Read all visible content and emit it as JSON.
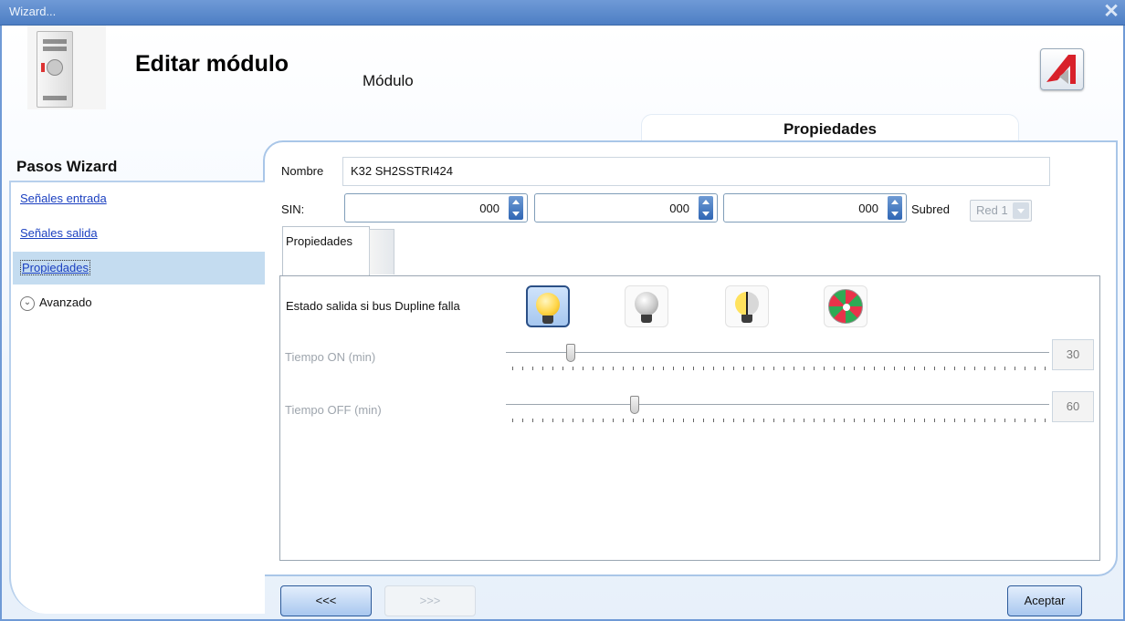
{
  "window": {
    "title": "Wizard..."
  },
  "header": {
    "title": "Editar módulo",
    "subtitle": "Módulo",
    "section_tab": "Propiedades"
  },
  "sidebar": {
    "title": "Pasos Wizard",
    "items": [
      {
        "label": "Señales entrada"
      },
      {
        "label": "Señales salida"
      },
      {
        "label": "Propiedades",
        "active": true
      },
      {
        "label": "Avanzado"
      }
    ]
  },
  "form": {
    "name_label": "Nombre",
    "name_value": "K32 SH2SSTRI424",
    "sin_label": "SIN:",
    "sin_values": [
      "000",
      "000",
      "000"
    ],
    "subnet_label": "Subred",
    "subnet_value": "Red 1"
  },
  "tabs": {
    "properties": "Propiedades"
  },
  "properties": {
    "state_label": "Estado salida si bus Dupline falla",
    "state_options": [
      "bulb-on-icon",
      "bulb-off-icon",
      "bulb-half-icon",
      "color-wheel-icon"
    ],
    "selected_option": 0,
    "time_on_label": "Tiempo ON (min)",
    "time_on_value": "30",
    "time_off_label": "Tiempo OFF (min)",
    "time_off_value": "60"
  },
  "buttons": {
    "back": "<<<",
    "next": ">>>",
    "accept": "Aceptar"
  },
  "colors": {
    "titlebar": "#5b88c9",
    "accent": "#a9c6e8",
    "link": "#1a3fc0",
    "active_item": "#c4dcf0"
  }
}
